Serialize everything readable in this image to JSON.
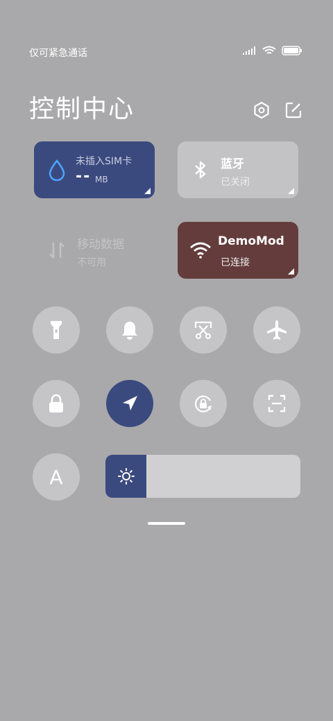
{
  "status_bar": {
    "carrier_text": "仅可紧急通话",
    "signal_icon": "signal-bars-icon",
    "wifi_icon": "wifi-icon",
    "battery_icon": "battery-icon"
  },
  "header": {
    "title": "控制中心",
    "settings_icon": "hexagon-settings-icon",
    "edit_icon": "edit-icon"
  },
  "tiles": {
    "data_usage": {
      "label": "未插入SIM卡",
      "value": "--",
      "unit": "MB",
      "icon": "water-drop-icon",
      "color": "#3b4a7e"
    },
    "bluetooth": {
      "label": "蓝牙",
      "status": "已关闭",
      "icon": "bluetooth-icon"
    },
    "mobile_data": {
      "label": "移动数据",
      "status": "不可用",
      "icon": "data-arrows-icon"
    },
    "wifi": {
      "label": "DemoMod",
      "status": "已连接",
      "icon": "wifi-icon",
      "color": "#643c3c"
    }
  },
  "toggles_row1": [
    {
      "name": "flashlight",
      "icon": "flashlight-icon",
      "active": false
    },
    {
      "name": "ringer",
      "icon": "bell-icon",
      "active": false
    },
    {
      "name": "screenshot",
      "icon": "screenshot-scissors-icon",
      "active": false
    },
    {
      "name": "airplane",
      "icon": "airplane-icon",
      "active": false
    }
  ],
  "toggles_row2": [
    {
      "name": "lock",
      "icon": "lock-icon",
      "active": false
    },
    {
      "name": "location",
      "icon": "location-arrow-icon",
      "active": true
    },
    {
      "name": "rotation-lock",
      "icon": "rotation-lock-icon",
      "active": false
    },
    {
      "name": "scanner",
      "icon": "scan-icon",
      "active": false
    }
  ],
  "toggles_row3": [
    {
      "name": "auto-brightness",
      "icon": "letter-a-icon",
      "label": "A",
      "active": false
    }
  ],
  "brightness": {
    "icon": "sun-icon",
    "level": 0.21,
    "fill_color": "#3b4a7e"
  }
}
